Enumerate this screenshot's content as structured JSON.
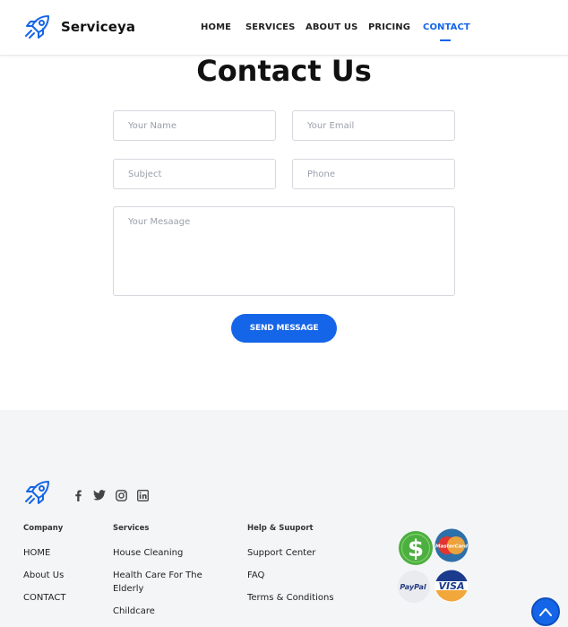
{
  "header": {
    "brand": "Serviceya",
    "nav": [
      "HOME",
      "SERVICES",
      "ABOUT US",
      "PRICING",
      "CONTACT"
    ],
    "active_nav": "CONTACT"
  },
  "contact": {
    "title": "Contact Us",
    "name_placeholder": "Your Name",
    "email_placeholder": "Your Email",
    "subject_placeholder": "Subject",
    "phone_placeholder": "Phone",
    "message_placeholder": "Your Mesaage",
    "send_label": "SEND MESSAGE"
  },
  "footer": {
    "social_icons": [
      "facebook-icon",
      "twitter-icon",
      "instagram-icon",
      "linkedin-icon"
    ],
    "company": {
      "heading": "Company",
      "links": [
        "HOME",
        "About Us",
        "CONTACT"
      ]
    },
    "services": {
      "heading": "Services",
      "links": [
        "House Cleaning",
        "Health Care For The Elderly",
        "Childcare"
      ]
    },
    "help": {
      "heading": "Help & Suuport",
      "links": [
        "Support Center",
        "FAQ",
        "Terms & Conditions"
      ]
    },
    "payments": {
      "paypal": "PayPal",
      "visa": "VISA",
      "mastercard": "MasterCard"
    }
  },
  "colors": {
    "accent": "#1565e8",
    "footer_bg": "#f4f5f7"
  }
}
